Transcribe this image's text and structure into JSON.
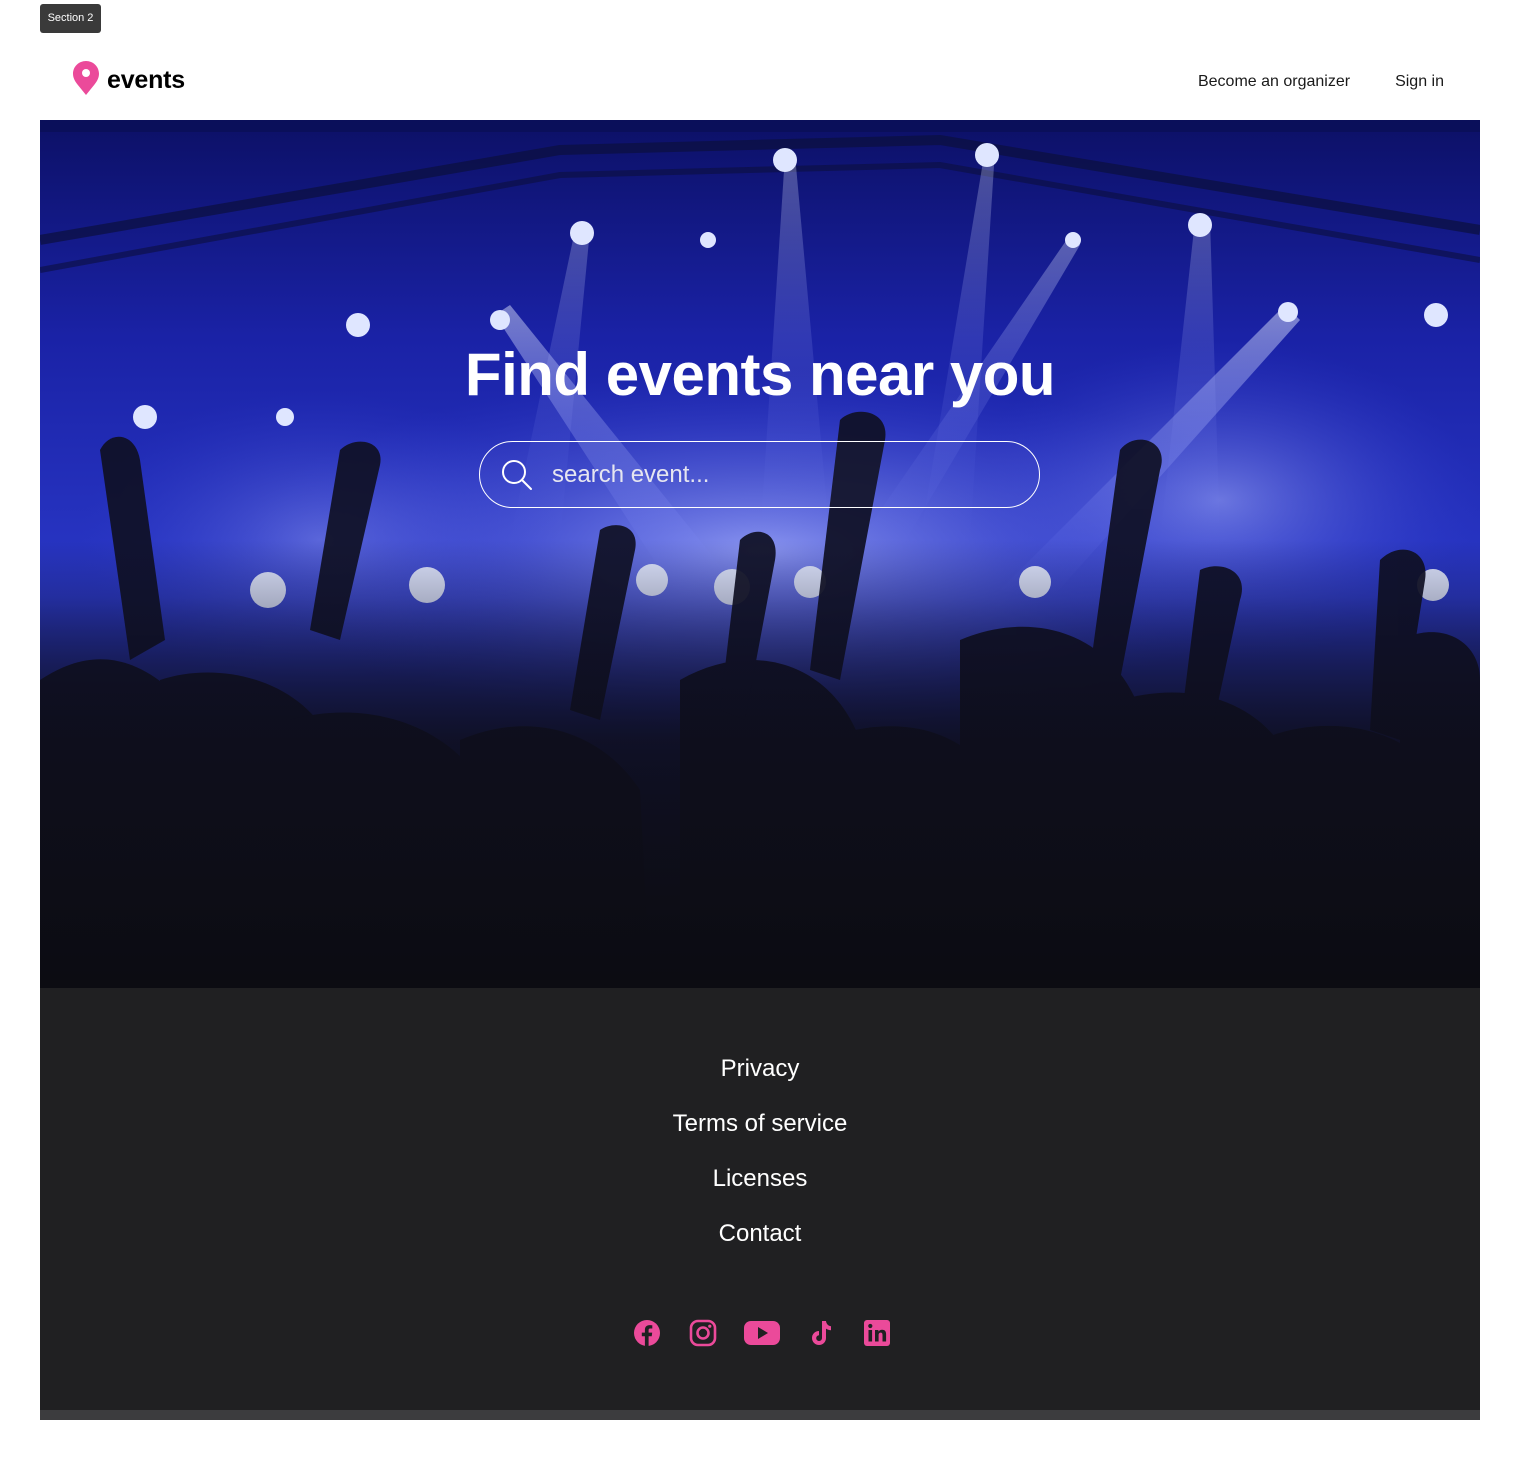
{
  "frame_label": "Section 2",
  "header": {
    "brand": "events",
    "nav": [
      {
        "label": "Become an organizer"
      },
      {
        "label": "Sign in"
      }
    ]
  },
  "hero": {
    "title": "Find events near you",
    "search": {
      "placeholder": "search event...",
      "value": ""
    }
  },
  "footer": {
    "links": [
      {
        "label": "Privacy"
      },
      {
        "label": "Terms of service"
      },
      {
        "label": "Licenses"
      },
      {
        "label": "Contact"
      }
    ],
    "social": [
      {
        "icon": "facebook-icon"
      },
      {
        "icon": "instagram-icon"
      },
      {
        "icon": "youtube-icon"
      },
      {
        "icon": "tiktok-icon"
      },
      {
        "icon": "linkedin-icon"
      }
    ]
  },
  "colors": {
    "accent": "#EB4A9A",
    "footer_bg": "#202022",
    "hero_tint": "#1E2AB8"
  }
}
